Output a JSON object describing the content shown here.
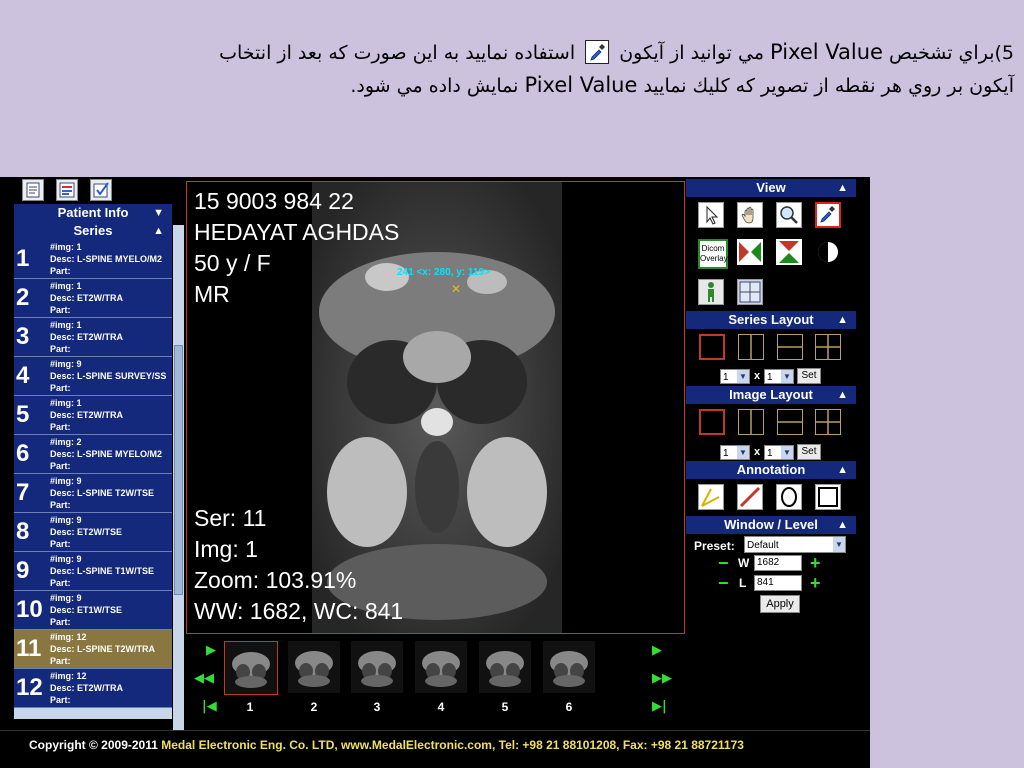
{
  "caption": {
    "line1_part1": "5)براي تشخيص ",
    "line1_en1": "Pixel Value",
    "line1_part2": " مي توانيد از آيكون",
    "line1_part3": "استفاده نماييد به اين صورت كه بعد از انتخاب",
    "line2_part1": "آيكون بر روي هر نقطه از تصوير كه كليك نماييد ",
    "line2_en": "Pixel Value",
    "line2_part2": " نمايش داده مي شود."
  },
  "left": {
    "patient_info_label": "Patient Info",
    "patient_info_arrow": "▼",
    "series_label": "Series",
    "series_arrow": "▲",
    "series": [
      {
        "num": "1",
        "img": "#img: 1",
        "desc": "Desc: L-SPINE MYELO/M2",
        "part": "Part:",
        "selected": false
      },
      {
        "num": "2",
        "img": "#img: 1",
        "desc": "Desc: ET2W/TRA",
        "part": "Part:",
        "selected": false
      },
      {
        "num": "3",
        "img": "#img: 1",
        "desc": "Desc: ET2W/TRA",
        "part": "Part:",
        "selected": false
      },
      {
        "num": "4",
        "img": "#img: 9",
        "desc": "Desc: L-SPINE SURVEY/SS",
        "part": "Part:",
        "selected": false
      },
      {
        "num": "5",
        "img": "#img: 1",
        "desc": "Desc: ET2W/TRA",
        "part": "Part:",
        "selected": false
      },
      {
        "num": "6",
        "img": "#img: 2",
        "desc": "Desc: L-SPINE MYELO/M2",
        "part": "Part:",
        "selected": false
      },
      {
        "num": "7",
        "img": "#img: 9",
        "desc": "Desc: L-SPINE T2W/TSE",
        "part": "Part:",
        "selected": false
      },
      {
        "num": "8",
        "img": "#img: 9",
        "desc": "Desc: ET2W/TSE",
        "part": "Part:",
        "selected": false
      },
      {
        "num": "9",
        "img": "#img: 9",
        "desc": "Desc: L-SPINE T1W/TSE",
        "part": "Part:",
        "selected": false
      },
      {
        "num": "10",
        "img": "#img: 9",
        "desc": "Desc: ET1W/TSE",
        "part": "Part:",
        "selected": false
      },
      {
        "num": "11",
        "img": "#img: 12",
        "desc": "Desc: L-SPINE T2W/TRA",
        "part": "Part:",
        "selected": true
      },
      {
        "num": "12",
        "img": "#img: 12",
        "desc": "Desc: ET2W/TRA",
        "part": "Part:",
        "selected": false
      }
    ]
  },
  "viewer": {
    "patient_id": "15 9003 984 22",
    "patient_name": "HEDAYAT AGHDAS",
    "age_sex": "50 y / F",
    "modality": "MR",
    "series": "Ser: 11",
    "image": "Img: 1",
    "zoom": "Zoom: 103.91%",
    "window": "WW: 1682, WC: 841",
    "pixel_readout": "241 <x: 280, y: 119>",
    "cursor_mark": "✕"
  },
  "thumbnails": {
    "labels": [
      "1",
      "2",
      "3",
      "4",
      "5",
      "6"
    ],
    "selected_index": 0
  },
  "right": {
    "view_label": "View",
    "series_layout_label": "Series Layout",
    "image_layout_label": "Image Layout",
    "annotation_label": "Annotation",
    "wl_label": "Window / Level",
    "arrow": "▲",
    "dicom_overlay_line1": "Dicom",
    "dicom_overlay_line2": "Overlay",
    "series_rows": "1",
    "series_cols": "1",
    "image_rows": "1",
    "image_cols": "1",
    "x_label": "x",
    "set_label": "Set",
    "preset_label": "Preset:",
    "preset_value": "Default",
    "w_label": "W",
    "l_label": "L",
    "w_value": "1682",
    "l_value": "841",
    "minus": "−",
    "plus": "+",
    "apply_label": "Apply"
  },
  "footer": {
    "prefix": "Copyright © 2009-2011 ",
    "highlight": "Medal Electronic Eng. Co. LTD, www.MedalElectronic.com, Tel: +98 21 88101208, Fax: +98 21 88721173"
  },
  "colors": {
    "slide_bg": "#cdc2de",
    "panel_blue": "#14287c",
    "selected_series": "#8a7640",
    "accent_green": "#33dd33",
    "active_red": "#c0392b"
  }
}
